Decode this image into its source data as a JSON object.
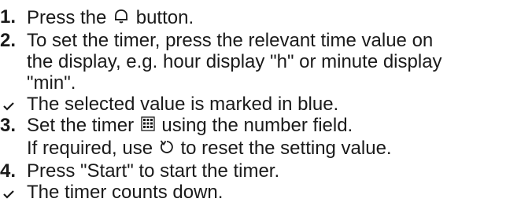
{
  "steps": [
    {
      "marker": "",
      "parts": [
        "…",
        "…"
      ]
    },
    {
      "marker": "1.",
      "before": "Press the",
      "icon": "bell-icon",
      "after": "button."
    },
    {
      "marker": "2.",
      "line1": "To set the timer, press the relevant time value on",
      "line2": "the display, e.g. hour display \"h\" or minute display",
      "line3": "\"min\"."
    },
    {
      "marker": "check",
      "text": "The selected value is marked in blue."
    },
    {
      "marker": "3.",
      "before": "Set the timer",
      "icon": "keypad-icon",
      "after": "using the number field.",
      "line2_before": "If required, use",
      "line2_icon": "reset-icon",
      "line2_after": "to reset the setting value."
    },
    {
      "marker": "4.",
      "text": "Press \"Start\" to start the timer."
    },
    {
      "marker": "check",
      "text": "The timer counts down."
    }
  ],
  "top_partial_text": "",
  "colors": {
    "text": "#1a1a1a",
    "background": "#ffffff"
  }
}
